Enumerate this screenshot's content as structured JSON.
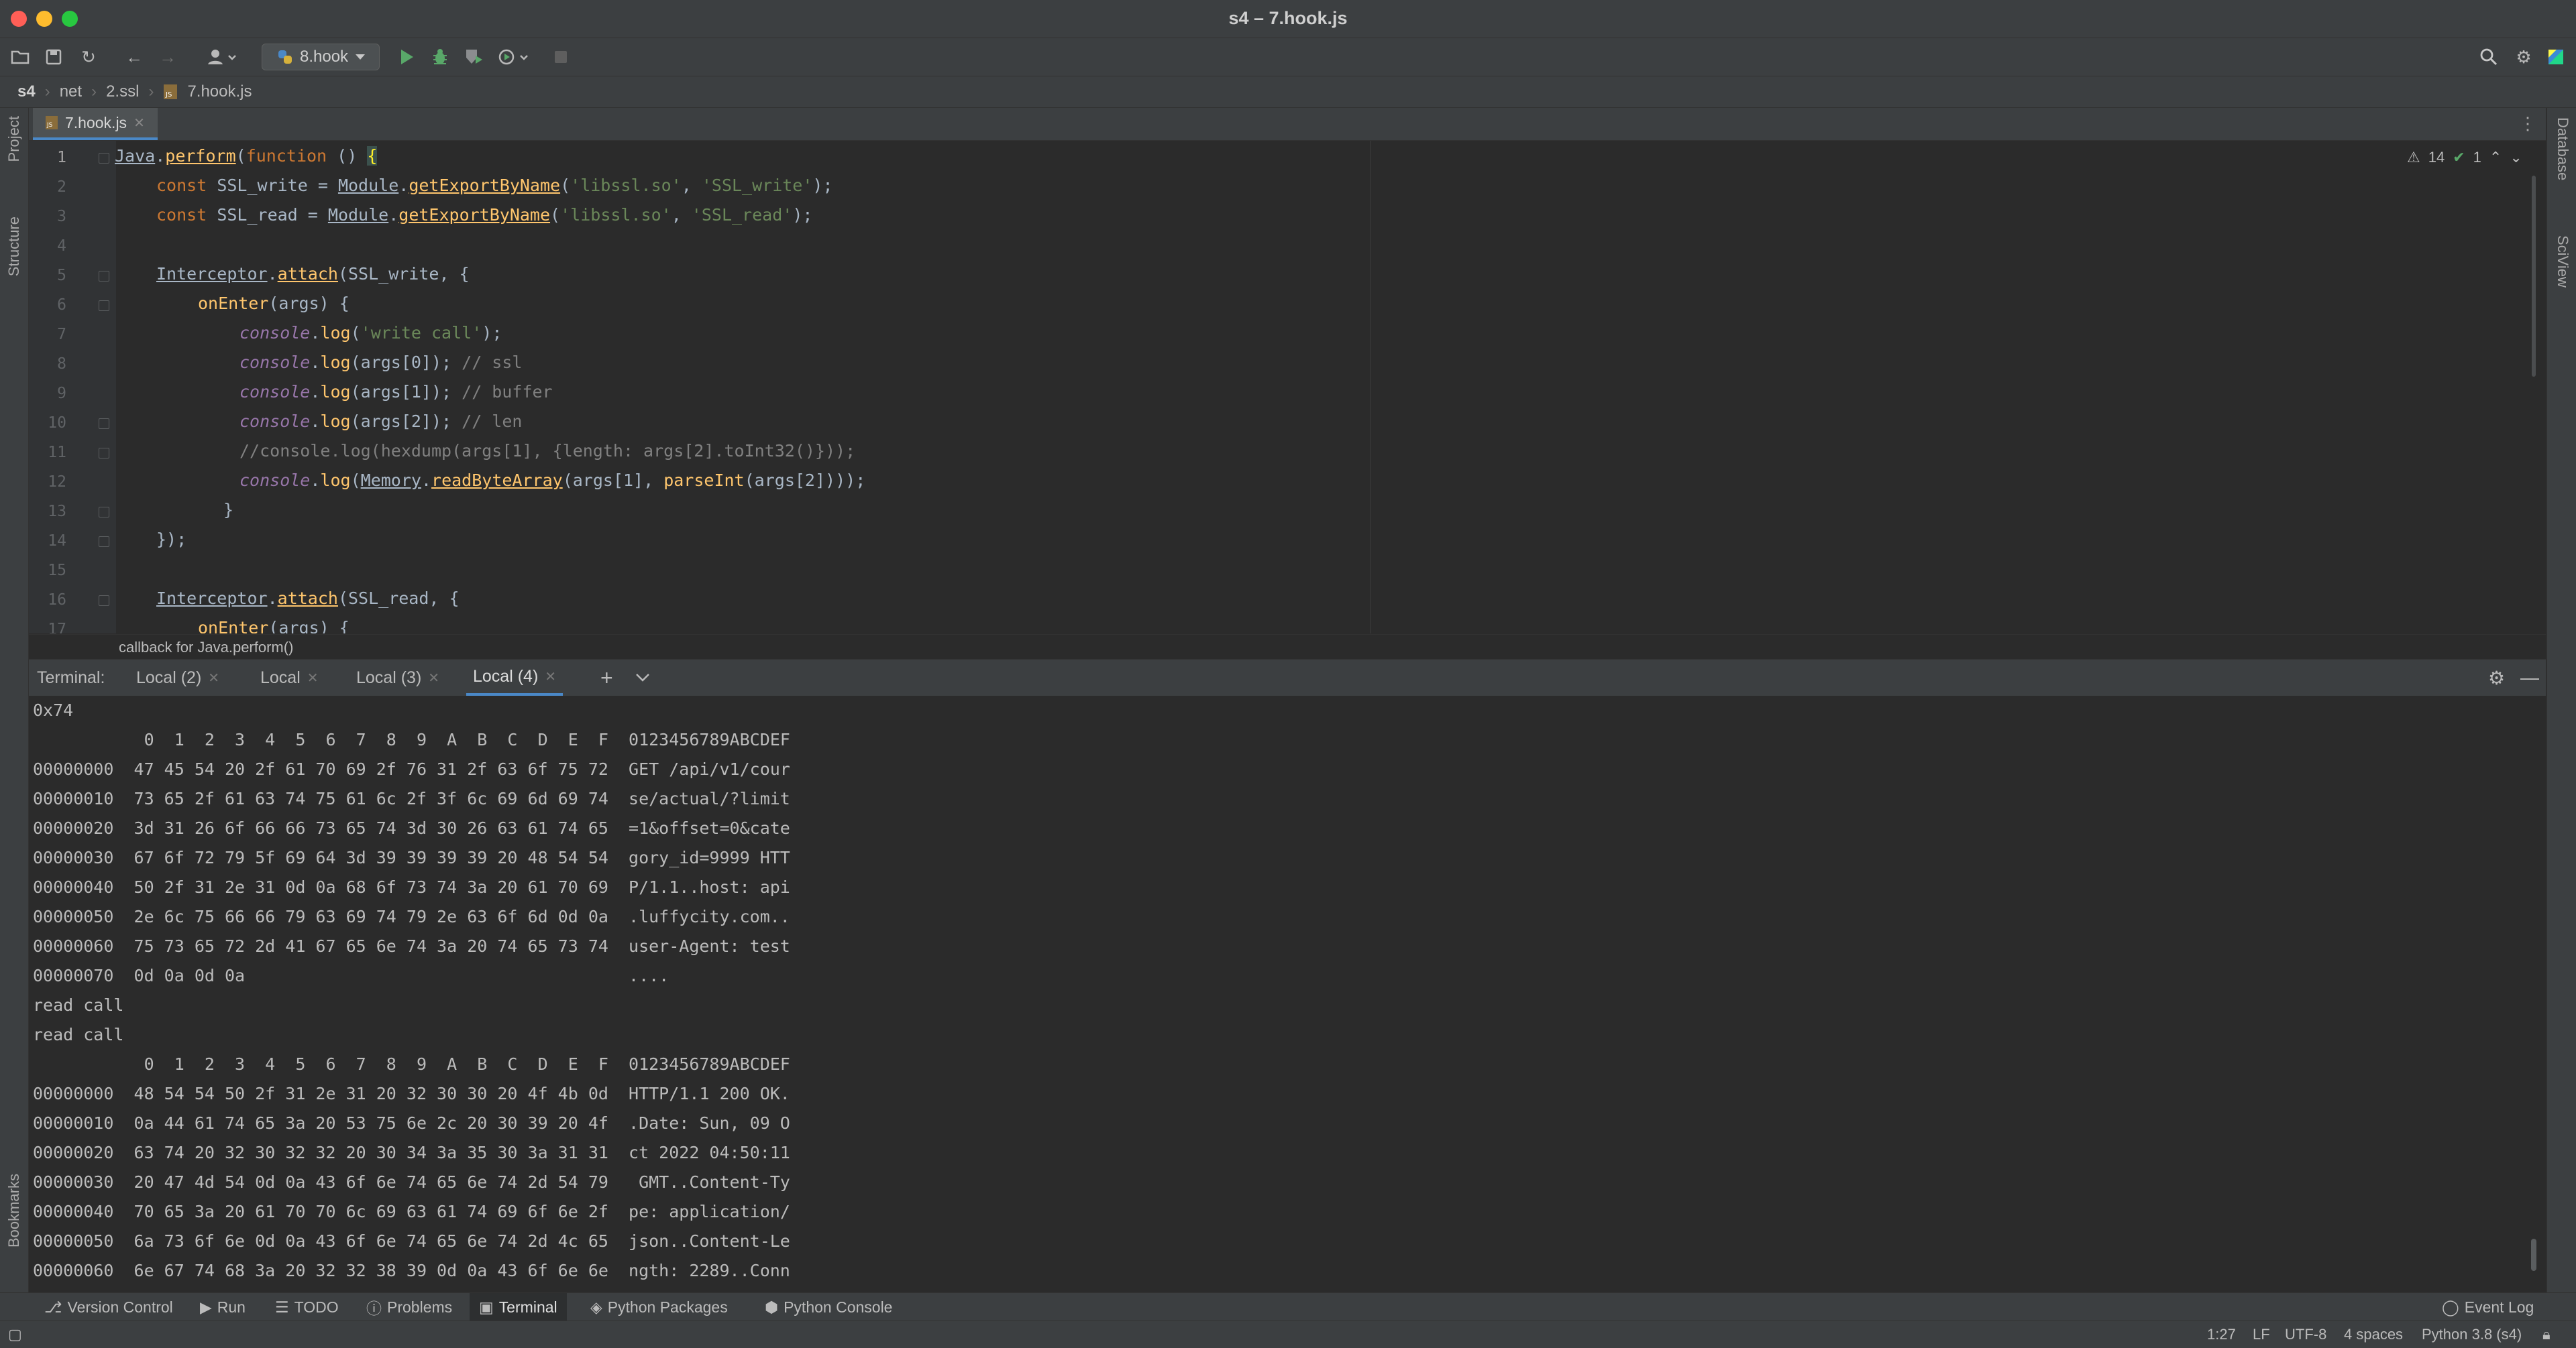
{
  "window": {
    "title": "s4 – 7.hook.js"
  },
  "toolbar": {
    "run_config": "8.hook"
  },
  "breadcrumb": [
    "s4",
    "net",
    "2.ssl",
    "7.hook.js"
  ],
  "side_left": {
    "project": "Project",
    "structure": "Structure",
    "bookmarks": "Bookmarks"
  },
  "side_right": {
    "database": "Database",
    "sciview": "SciView"
  },
  "editor": {
    "tab": "7.hook.js",
    "warnings": "14",
    "checks": "1",
    "line_numbers": [
      "1",
      "2",
      "3",
      "4",
      "5",
      "6",
      "7",
      "8",
      "9",
      "10",
      "11",
      "12",
      "13",
      "14",
      "15",
      "16",
      "17"
    ],
    "hint": "callback for Java.perform()",
    "t": {
      "java": "Java",
      "dot": ".",
      "perform": "perform",
      "paren_open": "(",
      "function": "function",
      "fn_tail": " () ",
      "brace_open": "{",
      "const": "const",
      "ssl_write_decl": " SSL_write = ",
      "ssl_read_decl": " SSL_read = ",
      "module": "Module",
      "get_export": "getExportByName",
      "libssl": "'libssl.so'",
      "comma_sp": ", ",
      "ssl_write_str": "'SSL_write'",
      "ssl_read_str": "'SSL_read'",
      "close_semi": ");",
      "interceptor": "Interceptor",
      "attach": "attach",
      "ssl_write_arg": "(SSL_write, {",
      "ssl_read_arg": "(SSL_read, {",
      "on_enter": "onEnter",
      "args_open": "(args) {",
      "console": "console",
      "log": "log",
      "write_call_str": "'write call'",
      "args0": "(args[0]);",
      "args1": "(args[1]);",
      "args2": "(args[2]);",
      "cm_ssl": " // ssl",
      "cm_buffer": " // buffer",
      "cm_len": " // len",
      "hexdump_comment": "//console.log(hexdump(args[1], {length: args[2].toInt32()}));",
      "memory": "Memory",
      "read_byte_array": "readByteArray",
      "args1_comma": "(args[1], ",
      "parse_int": "parseInt",
      "args2_close": "(args[2])));",
      "close_brace": "}",
      "close_obj": "});"
    }
  },
  "terminal": {
    "label": "Terminal:",
    "tabs": [
      "Local (2)",
      "Local",
      "Local (3)",
      "Local (4)"
    ],
    "active_tab": 3,
    "lines": [
      "0x74",
      "           0  1  2  3  4  5  6  7  8  9  A  B  C  D  E  F  0123456789ABCDEF",
      "00000000  47 45 54 20 2f 61 70 69 2f 76 31 2f 63 6f 75 72  GET /api/v1/cour",
      "00000010  73 65 2f 61 63 74 75 61 6c 2f 3f 6c 69 6d 69 74  se/actual/?limit",
      "00000020  3d 31 26 6f 66 66 73 65 74 3d 30 26 63 61 74 65  =1&offset=0&cate",
      "00000030  67 6f 72 79 5f 69 64 3d 39 39 39 39 20 48 54 54  gory_id=9999 HTT",
      "00000040  50 2f 31 2e 31 0d 0a 68 6f 73 74 3a 20 61 70 69  P/1.1..host: api",
      "00000050  2e 6c 75 66 66 79 63 69 74 79 2e 63 6f 6d 0d 0a  .luffycity.com..",
      "00000060  75 73 65 72 2d 41 67 65 6e 74 3a 20 74 65 73 74  user-Agent: test",
      "00000070  0d 0a 0d 0a                                      ....",
      "read call",
      "read call",
      "           0  1  2  3  4  5  6  7  8  9  A  B  C  D  E  F  0123456789ABCDEF",
      "00000000  48 54 54 50 2f 31 2e 31 20 32 30 30 20 4f 4b 0d  HTTP/1.1 200 OK.",
      "00000010  0a 44 61 74 65 3a 20 53 75 6e 2c 20 30 39 20 4f  .Date: Sun, 09 O",
      "00000020  63 74 20 32 30 32 32 20 30 34 3a 35 30 3a 31 31  ct 2022 04:50:11",
      "00000030  20 47 4d 54 0d 0a 43 6f 6e 74 65 6e 74 2d 54 79   GMT..Content-Ty",
      "00000040  70 65 3a 20 61 70 70 6c 69 63 61 74 69 6f 6e 2f  pe: application/",
      "00000050  6a 73 6f 6e 0d 0a 43 6f 6e 74 65 6e 74 2d 4c 65  json..Content-Le",
      "00000060  6e 67 74 68 3a 20 32 32 38 39 0d 0a 43 6f 6e 6e  ngth: 2289..Conn"
    ]
  },
  "bottom_tools": [
    "Version Control",
    "Run",
    "TODO",
    "Problems",
    "Terminal",
    "Python Packages",
    "Python Console"
  ],
  "active_bottom_tool": "Terminal",
  "event_log": "Event Log",
  "status": {
    "position": "1:27",
    "line_sep": "LF",
    "encoding": "UTF-8",
    "indent": "4 spaces",
    "interpreter": "Python 3.8 (s4)"
  },
  "colors": {
    "accent": "#4a88c7",
    "run_green": "#59a869",
    "close": "#ff5f57",
    "minimize": "#febc2e",
    "maximize": "#28c840"
  }
}
